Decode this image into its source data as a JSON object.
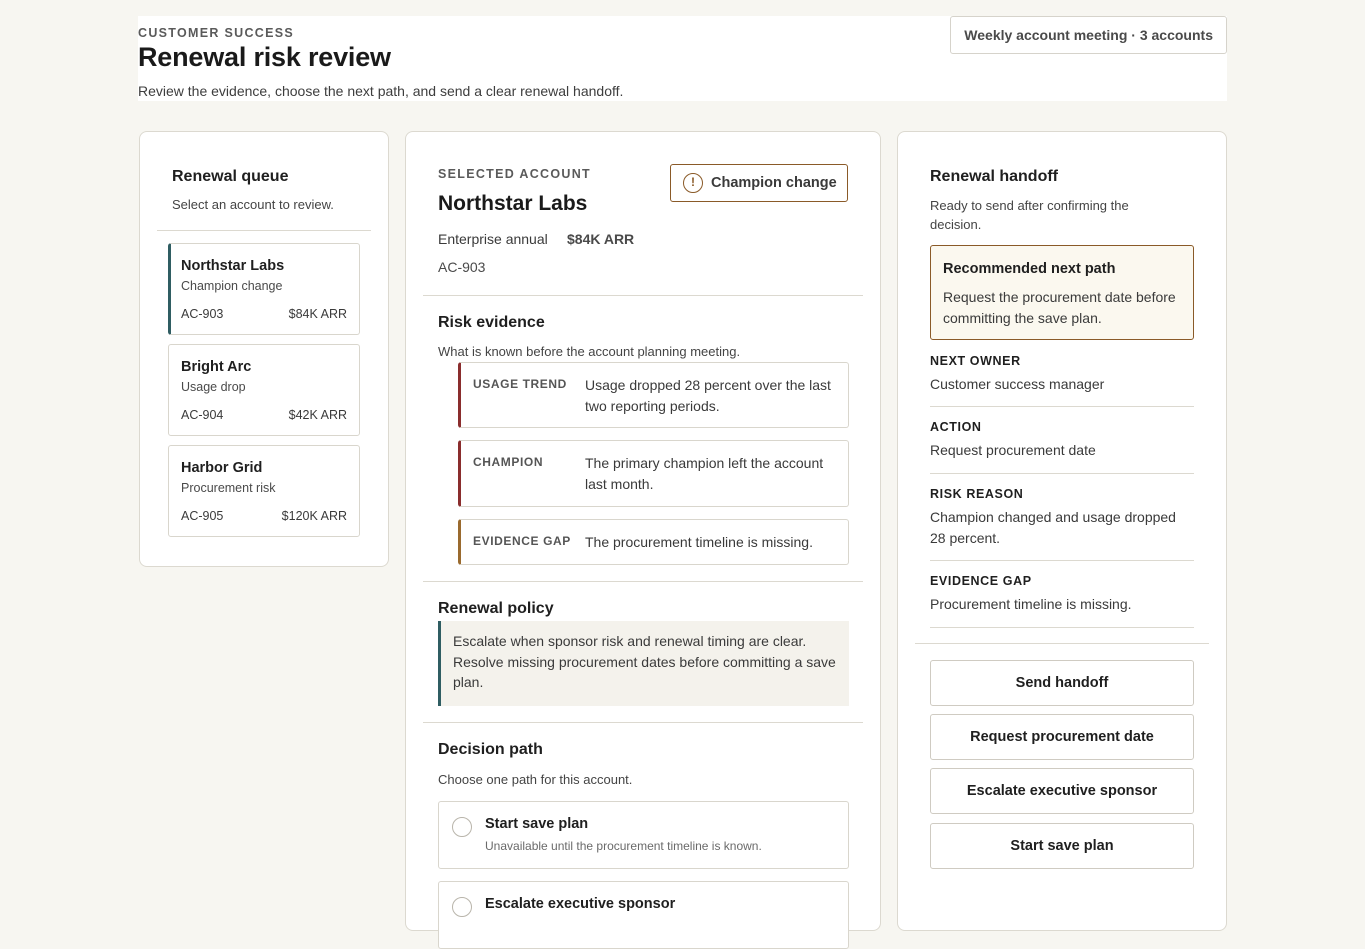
{
  "header": {
    "eyebrow": "CUSTOMER SUCCESS",
    "title": "Renewal risk review",
    "subtitle": "Review the evidence, choose the next path, and send a clear renewal handoff.",
    "meeting_chip": "Weekly account meeting · 3 accounts"
  },
  "queue": {
    "title": "Renewal queue",
    "hint": "Select an account to review.",
    "items": [
      {
        "name": "Northstar Labs",
        "reason": "Champion change",
        "id": "AC-903",
        "arr": "$84K ARR",
        "selected": true
      },
      {
        "name": "Bright Arc",
        "reason": "Usage drop",
        "id": "AC-904",
        "arr": "$42K ARR",
        "selected": false
      },
      {
        "name": "Harbor Grid",
        "reason": "Procurement risk",
        "id": "AC-905",
        "arr": "$120K ARR",
        "selected": false
      }
    ]
  },
  "account": {
    "eyebrow": "SELECTED ACCOUNT",
    "badge": "Champion change",
    "badge_icon": "alert-circle-icon",
    "name": "Northstar Labs",
    "plan": "Enterprise annual",
    "arr": "$84K ARR",
    "id": "AC-903"
  },
  "evidence": {
    "title": "Risk evidence",
    "hint": "What is known before the account planning meeting.",
    "items": [
      {
        "label": "USAGE TREND",
        "text": "Usage dropped 28 percent over the last two reporting periods."
      },
      {
        "label": "CHAMPION",
        "text": "The primary champion left the account last month."
      },
      {
        "label": "EVIDENCE GAP",
        "text": "The procurement timeline is missing."
      }
    ]
  },
  "policy": {
    "title": "Renewal policy",
    "text": "Escalate when sponsor risk and renewal timing are clear. Resolve missing procurement dates before committing a save plan."
  },
  "decision": {
    "title": "Decision path",
    "hint": "Choose one path for this account.",
    "options": [
      {
        "title": "Start save plan",
        "sub": "Unavailable until the procurement timeline is known."
      },
      {
        "title": "Escalate executive sponsor",
        "sub": ""
      }
    ]
  },
  "handoff": {
    "title": "Renewal handoff",
    "hint": "Ready to send after confirming the decision.",
    "recommend_title": "Recommended next path",
    "recommend_text": "Request the procurement date before committing the save plan.",
    "fields": [
      {
        "label": "NEXT OWNER",
        "value": "Customer success manager"
      },
      {
        "label": "ACTION",
        "value": "Request procurement date"
      },
      {
        "label": "RISK REASON",
        "value": "Champion changed and usage dropped 28 percent."
      },
      {
        "label": "EVIDENCE GAP",
        "value": "Procurement timeline is missing."
      }
    ],
    "buttons": [
      "Send handoff",
      "Request procurement date",
      "Escalate executive sponsor",
      "Start save plan"
    ]
  },
  "colors": {
    "page_bg": "#f7f6f1",
    "accent_teal": "#2f5d62",
    "warning_brown": "#8a5a28",
    "risk_red": "#8a2d2d"
  }
}
